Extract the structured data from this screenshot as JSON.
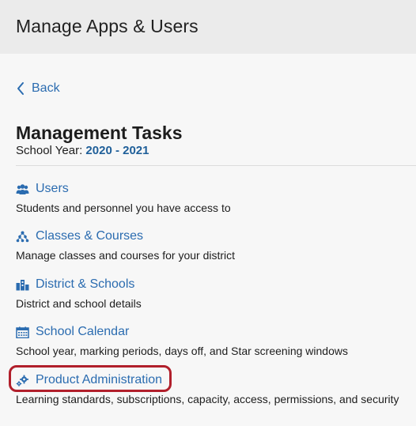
{
  "header": {
    "title": "Manage Apps & Users"
  },
  "nav": {
    "back_label": "Back"
  },
  "main": {
    "title": "Management Tasks",
    "school_year_label": "School Year:",
    "school_year_value": "2020 - 2021"
  },
  "tasks": [
    {
      "label": "Users",
      "description": "Students and personnel you have access to",
      "icon": "users-icon"
    },
    {
      "label": "Classes & Courses",
      "description": "Manage classes and courses for your district",
      "icon": "hierarchy-icon"
    },
    {
      "label": "District & Schools",
      "description": "District and school details",
      "icon": "buildings-icon"
    },
    {
      "label": "School Calendar",
      "description": "School year, marking periods, days off, and Star screening windows",
      "icon": "calendar-icon"
    },
    {
      "label": "Product Administration",
      "description": "Learning standards, subscriptions, capacity, access, permissions, and security",
      "icon": "gears-icon"
    }
  ],
  "colors": {
    "link": "#2b6cb0",
    "year": "#1f5f99",
    "highlight": "#b11f2b"
  }
}
